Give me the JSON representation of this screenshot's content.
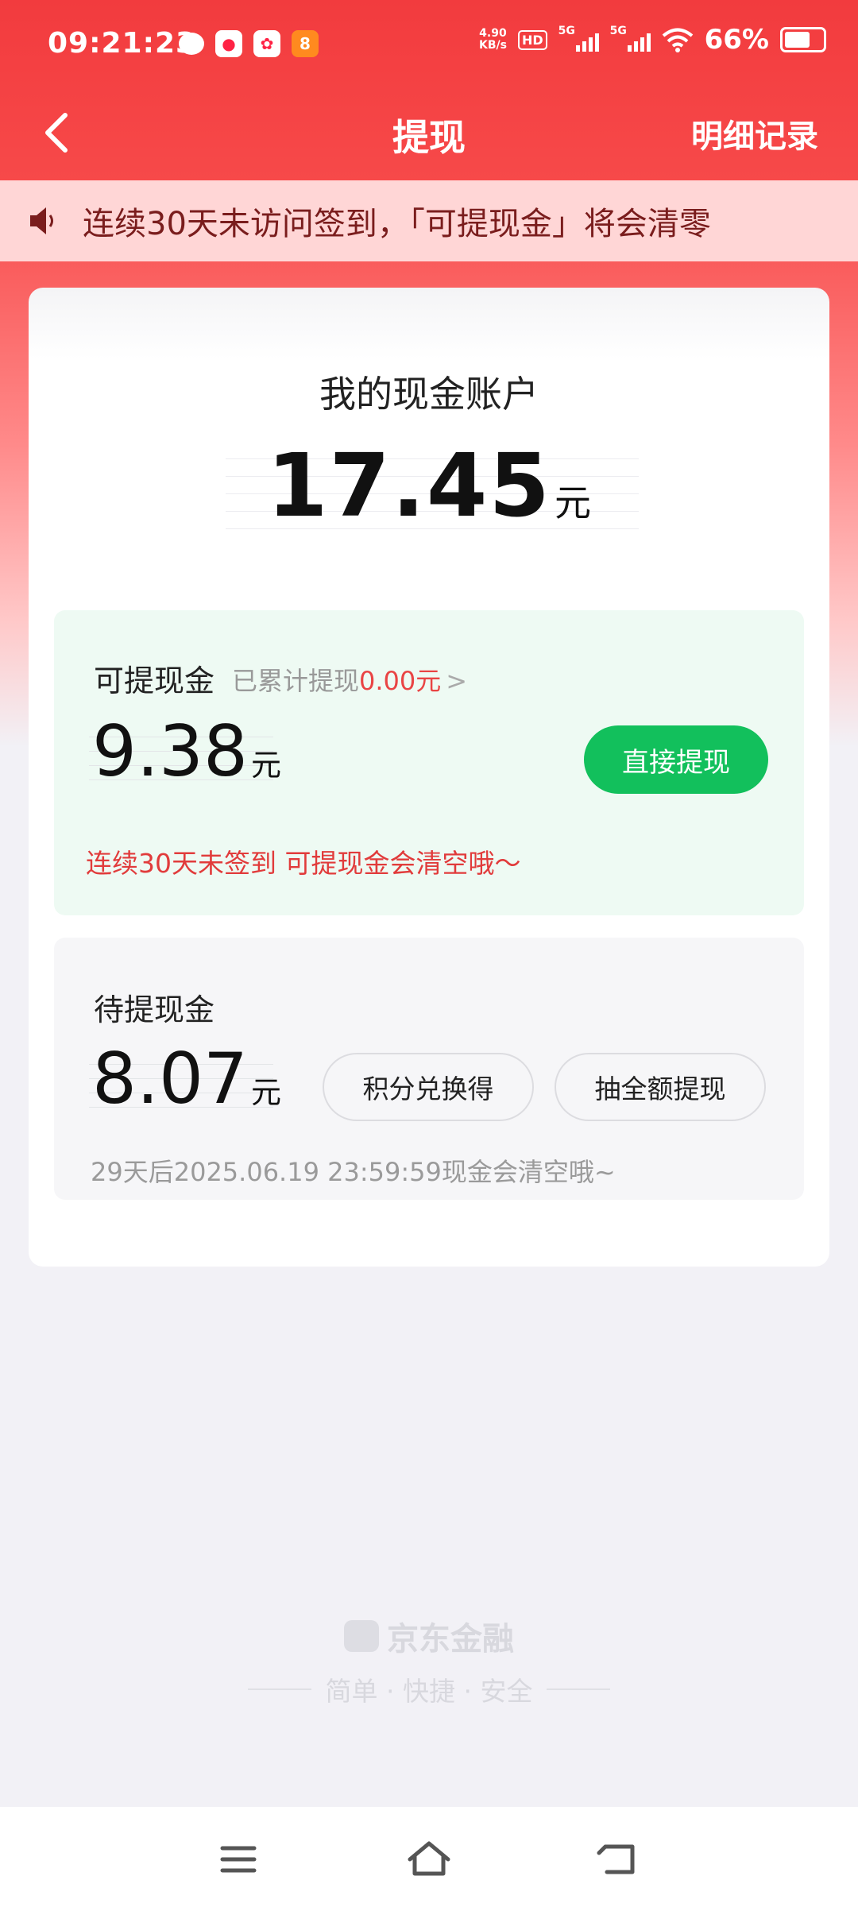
{
  "status_bar": {
    "time": "09:21:23",
    "net_speed_value": "4.90",
    "net_speed_unit": "KB/s",
    "hd_label": "HD",
    "signal1_label": "5G",
    "signal2_label": "5G",
    "battery": "66%"
  },
  "header": {
    "title": "提现",
    "detail_link": "明细记录"
  },
  "notice": {
    "text": "连续30天未访问签到，「可提现金」将会清零"
  },
  "account": {
    "title": "我的现金账户",
    "amount": "17.45",
    "unit": "元"
  },
  "withdrawable": {
    "label": "可提现金",
    "cumulative_prefix": "已累计提现",
    "cumulative_amount": "0.00元",
    "chevron": ">",
    "amount": "9.38",
    "unit": "元",
    "button": "直接提现",
    "warning": "连续30天未签到 可提现金会清空哦～"
  },
  "pending": {
    "label": "待提现金",
    "amount": "8.07",
    "unit": "元",
    "button_points": "积分兑换得",
    "button_lottery": "抽全额提现",
    "note": "29天后2025.06.19 23:59:59现金会清空哦~"
  },
  "footer": {
    "brand": "京东金融",
    "slogan": "简单 · 快捷 · 安全"
  },
  "colors": {
    "header_red": "#f23b3e",
    "green_button": "#12c05c",
    "warning_red": "#e13b3b"
  }
}
